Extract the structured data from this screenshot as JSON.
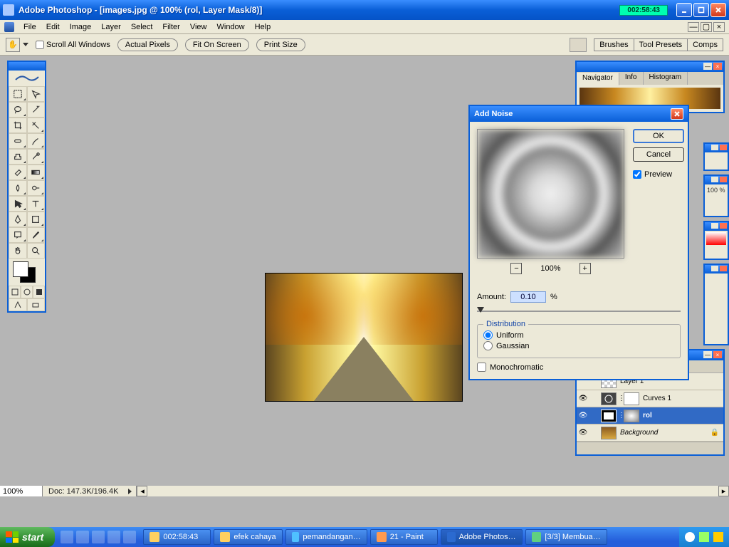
{
  "titlebar": {
    "text": "Adobe Photoshop - [images.jpg @ 100% (rol, Layer Mask/8)]",
    "timer": "002:58:43"
  },
  "menu": {
    "items": [
      "File",
      "Edit",
      "Image",
      "Layer",
      "Select",
      "Filter",
      "View",
      "Window",
      "Help"
    ]
  },
  "options": {
    "scroll_all": "Scroll All Windows",
    "btn_actual": "Actual Pixels",
    "btn_fit": "Fit On Screen",
    "btn_print": "Print Size",
    "palette_buttons": [
      "Brushes",
      "Tool Presets",
      "Comps"
    ]
  },
  "statusbar": {
    "zoom": "100%",
    "doc": "Doc: 147.3K/196.4K"
  },
  "navigator": {
    "tabs": [
      "Navigator",
      "Info",
      "Histogram"
    ]
  },
  "side_stubs": {
    "opacity_label": "100",
    "opacity_pct": "%"
  },
  "layers": {
    "rows": [
      {
        "name": "Layer 1"
      },
      {
        "name": "Curves 1"
      },
      {
        "name": "rol"
      },
      {
        "name": "Background"
      }
    ]
  },
  "dialog": {
    "title": "Add Noise",
    "ok": "OK",
    "cancel": "Cancel",
    "preview": "Preview",
    "zoom": "100%",
    "amount_label": "Amount:",
    "amount_value": "0.10",
    "amount_pct": "%",
    "dist_legend": "Distribution",
    "dist_uniform": "Uniform",
    "dist_gaussian": "Gaussian",
    "mono": "Monochromatic"
  },
  "taskbar": {
    "start": "start",
    "items": [
      "002:58:43",
      "efek cahaya",
      "pemandangan…",
      "21 - Paint",
      "Adobe Photos…",
      "[3/3] Membua…"
    ]
  }
}
